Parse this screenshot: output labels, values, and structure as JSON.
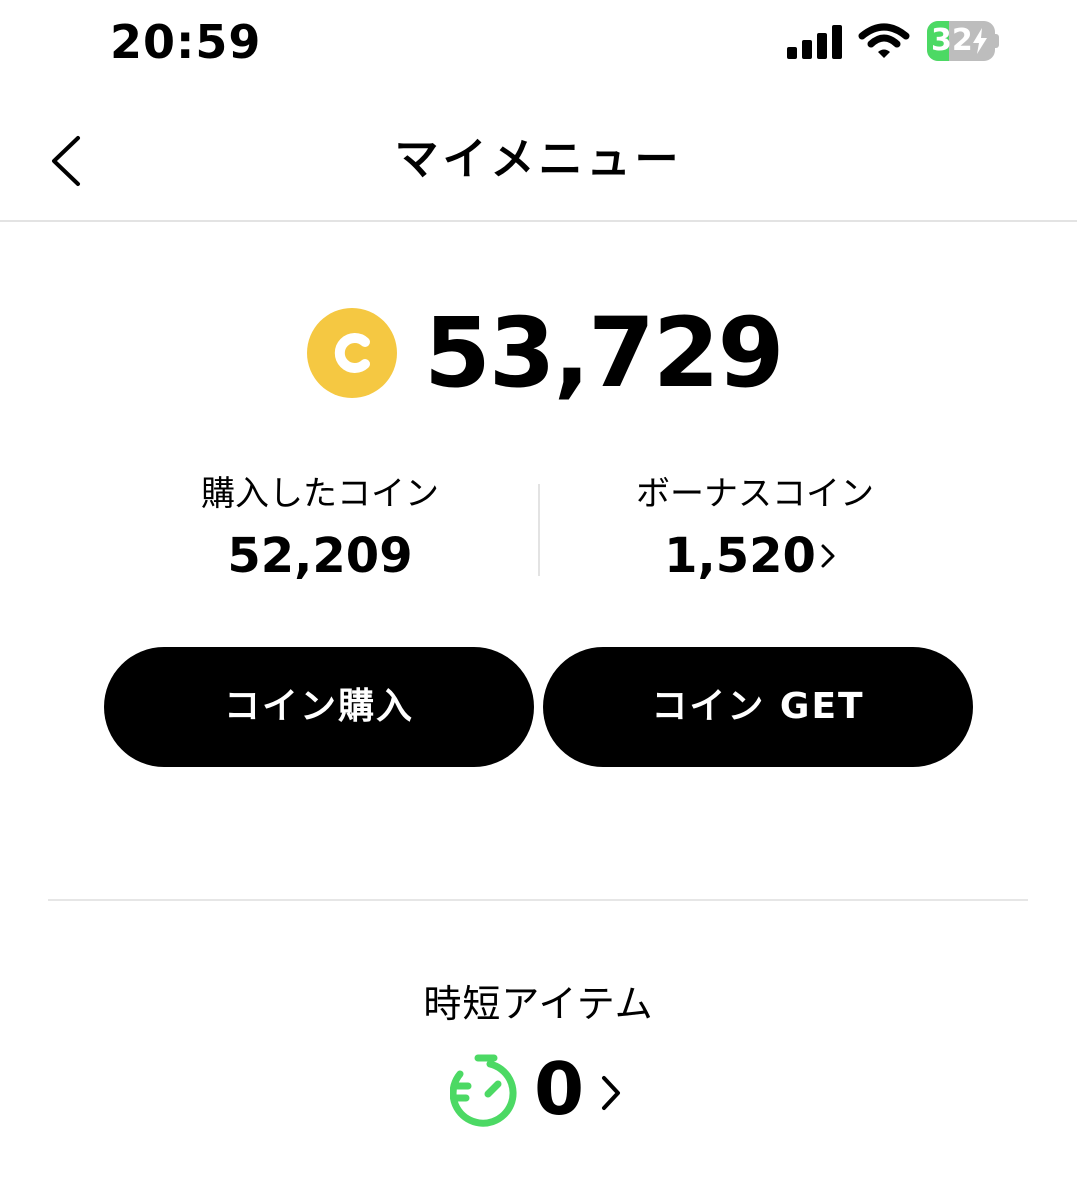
{
  "status_bar": {
    "time": "20:59",
    "battery_percent": "32",
    "battery_level": 0.32,
    "signal_icon": "cellular-signal-icon",
    "wifi_icon": "wifi-icon",
    "battery_icon": "battery-charging-icon"
  },
  "header": {
    "title": "マイメニュー",
    "back_icon": "chevron-left-icon"
  },
  "coins": {
    "icon": "coin-c-icon",
    "icon_letter": "C",
    "icon_color": "#F5C842",
    "total": "53,729",
    "purchased_label": "購入したコイン",
    "purchased_value": "52,209",
    "bonus_label": "ボーナスコイン",
    "bonus_value": "1,520"
  },
  "actions": {
    "buy_label": "コイン購入",
    "get_label": "コイン GET"
  },
  "time_saving": {
    "title": "時短アイテム",
    "count": "0",
    "icon": "timer-icon",
    "icon_color": "#4CD964"
  }
}
